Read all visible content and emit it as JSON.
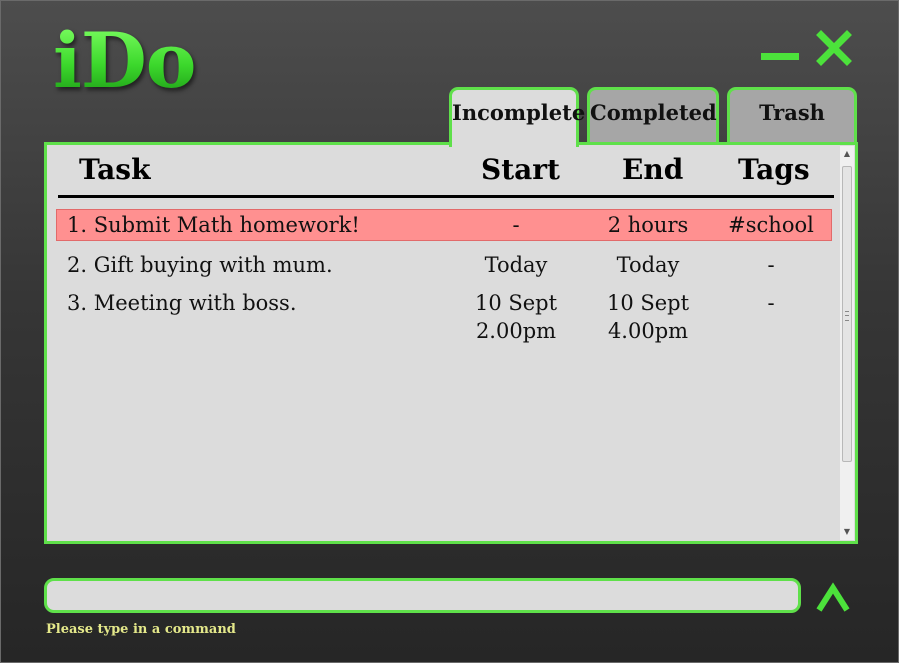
{
  "app": {
    "logo": "iDo"
  },
  "window_controls": {
    "minimize_icon": "minimize-icon",
    "close_icon": "close-icon"
  },
  "tabs": [
    {
      "label": "Incomplete",
      "active": true
    },
    {
      "label": "Completed",
      "active": false
    },
    {
      "label": "Trash",
      "active": false
    }
  ],
  "table": {
    "headers": {
      "task": "Task",
      "start": "Start",
      "end": "End",
      "tags": "Tags"
    },
    "rows": [
      {
        "task": "1. Submit Math homework!",
        "start": "-",
        "end": "2 hours",
        "tags": "#school",
        "highlighted": true
      },
      {
        "task": "2. Gift buying with mum.",
        "start": "Today",
        "end": "Today",
        "tags": "-",
        "highlighted": false
      },
      {
        "task": "3. Meeting with boss.",
        "start_line1": "10 Sept",
        "start_line2": "2.00pm",
        "end_line1": "10 Sept",
        "end_line2": "4.00pm",
        "tags": "-",
        "highlighted": false
      }
    ]
  },
  "command": {
    "value": "",
    "placeholder": "",
    "hint": "Please type in a command",
    "submit_icon": "chevron-up-icon"
  },
  "colors": {
    "accent": "#5fe04a",
    "highlight_row": "#ff9090",
    "panel_bg": "#dcdcdc",
    "hint_text": "#e4e88a"
  }
}
